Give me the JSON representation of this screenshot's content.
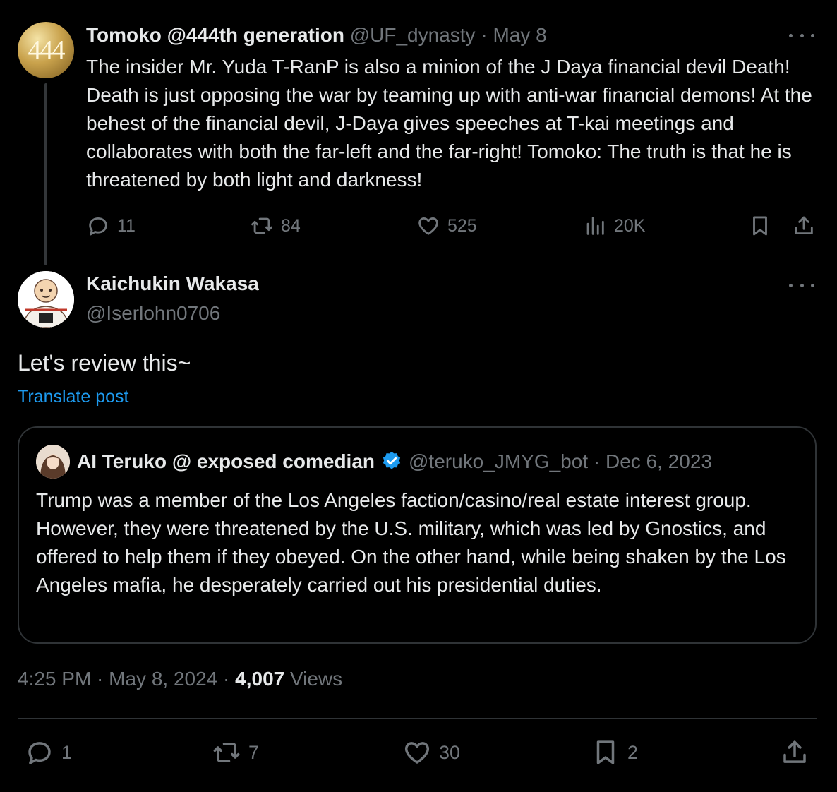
{
  "parent_tweet": {
    "avatar_text": "444",
    "name": "Tomoko @444th generation",
    "handle": "@UF_dynasty",
    "date": "· May 8",
    "text": "The insider Mr. Yuda T-RanP is also a minion of the J Daya financial devil Death! Death is just opposing the war by teaming up with anti-war financial demons! At the behest of the financial devil, J-Daya gives speeches at T-kai meetings and collaborates with both the far-left and the far-right! Tomoko: The truth is that he is threatened by both light and darkness!",
    "replies": "11",
    "reposts": "84",
    "likes": "525",
    "views": "20K"
  },
  "main_tweet": {
    "name": "Kaichukin Wakasa",
    "handle": "@Iserlohn0706",
    "text": "Let's review this~",
    "translate_label": "Translate post",
    "time": "4:25 PM · May 8, 2024 · ",
    "views_count": "4,007",
    "views_label": " Views",
    "replies": "1",
    "reposts": "7",
    "likes": "30",
    "bookmarks": "2"
  },
  "quoted_tweet": {
    "name": "AI Teruko @ exposed comedian",
    "handle": "@teruko_JMYG_bot · Dec 6, 2023",
    "text": "Trump was a member of the Los Angeles faction/casino/real estate interest group. However, they were threatened by the U.S. military, which was led by Gnostics, and offered to help them if they obeyed. On the other hand, while being shaken by the Los Angeles mafia, he desperately carried out his presidential duties."
  },
  "colors": {
    "background": "#000000",
    "text": "#e7e9ea",
    "secondary": "#71767b",
    "link": "#1d9bf0",
    "border": "#2f3336",
    "verified": "#1d9bf0"
  }
}
